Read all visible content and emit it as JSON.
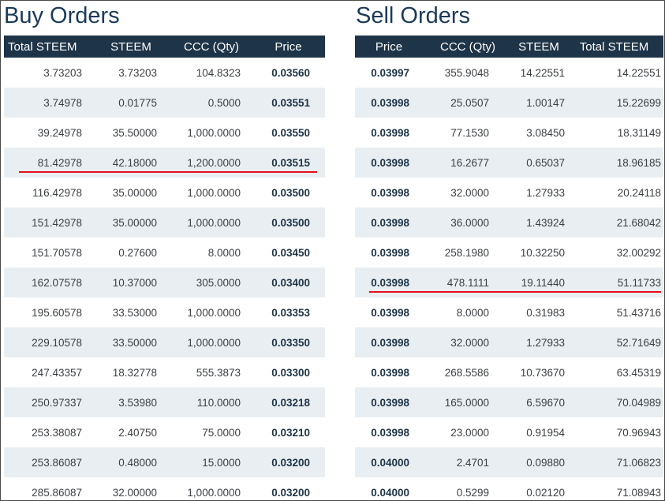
{
  "buy": {
    "title": "Buy Orders",
    "columns": [
      "Total STEEM",
      "STEEM",
      "CCC (Qty)",
      "Price"
    ],
    "rows": [
      [
        "3.73203",
        "3.73203",
        "104.8323",
        "0.03560"
      ],
      [
        "3.74978",
        "0.01775",
        "0.5000",
        "0.03551"
      ],
      [
        "39.24978",
        "35.50000",
        "1,000.0000",
        "0.03550"
      ],
      [
        "81.42978",
        "42.18000",
        "1,200.0000",
        "0.03515"
      ],
      [
        "116.42978",
        "35.00000",
        "1,000.0000",
        "0.03500"
      ],
      [
        "151.42978",
        "35.00000",
        "1,000.0000",
        "0.03500"
      ],
      [
        "151.70578",
        "0.27600",
        "8.0000",
        "0.03450"
      ],
      [
        "162.07578",
        "10.37000",
        "305.0000",
        "0.03400"
      ],
      [
        "195.60578",
        "33.53000",
        "1,000.0000",
        "0.03353"
      ],
      [
        "229.10578",
        "33.50000",
        "1,000.0000",
        "0.03350"
      ],
      [
        "247.43357",
        "18.32778",
        "555.3873",
        "0.03300"
      ],
      [
        "250.97337",
        "3.53980",
        "110.0000",
        "0.03218"
      ],
      [
        "253.38087",
        "2.40750",
        "75.0000",
        "0.03210"
      ],
      [
        "253.86087",
        "0.48000",
        "15.0000",
        "0.03200"
      ],
      [
        "285.86087",
        "32.00000",
        "1,000.0000",
        "0.03200"
      ]
    ]
  },
  "sell": {
    "title": "Sell Orders",
    "columns": [
      "Price",
      "CCC (Qty)",
      "STEEM",
      "Total STEEM"
    ],
    "rows": [
      [
        "0.03997",
        "355.9048",
        "14.22551",
        "14.22551"
      ],
      [
        "0.03998",
        "25.0507",
        "1.00147",
        "15.22699"
      ],
      [
        "0.03998",
        "77.1530",
        "3.08450",
        "18.31149"
      ],
      [
        "0.03998",
        "16.2677",
        "0.65037",
        "18.96185"
      ],
      [
        "0.03998",
        "32.0000",
        "1.27933",
        "20.24118"
      ],
      [
        "0.03998",
        "36.0000",
        "1.43924",
        "21.68042"
      ],
      [
        "0.03998",
        "258.1980",
        "10.32250",
        "32.00292"
      ],
      [
        "0.03998",
        "478.1111",
        "19.11440",
        "51.11733"
      ],
      [
        "0.03998",
        "8.0000",
        "0.31983",
        "51.43716"
      ],
      [
        "0.03998",
        "32.0000",
        "1.27933",
        "52.71649"
      ],
      [
        "0.03998",
        "268.5586",
        "10.73670",
        "63.45319"
      ],
      [
        "0.03998",
        "165.0000",
        "6.59670",
        "70.04989"
      ],
      [
        "0.03998",
        "23.0000",
        "0.91954",
        "70.96943"
      ],
      [
        "0.04000",
        "2.4701",
        "0.09880",
        "71.06823"
      ],
      [
        "0.04000",
        "0.5299",
        "0.02120",
        "71.08943"
      ]
    ]
  },
  "annotations": {
    "underline_color": "#e8101a",
    "buy_underlined_row": 4,
    "sell_underlined_row": 8
  }
}
